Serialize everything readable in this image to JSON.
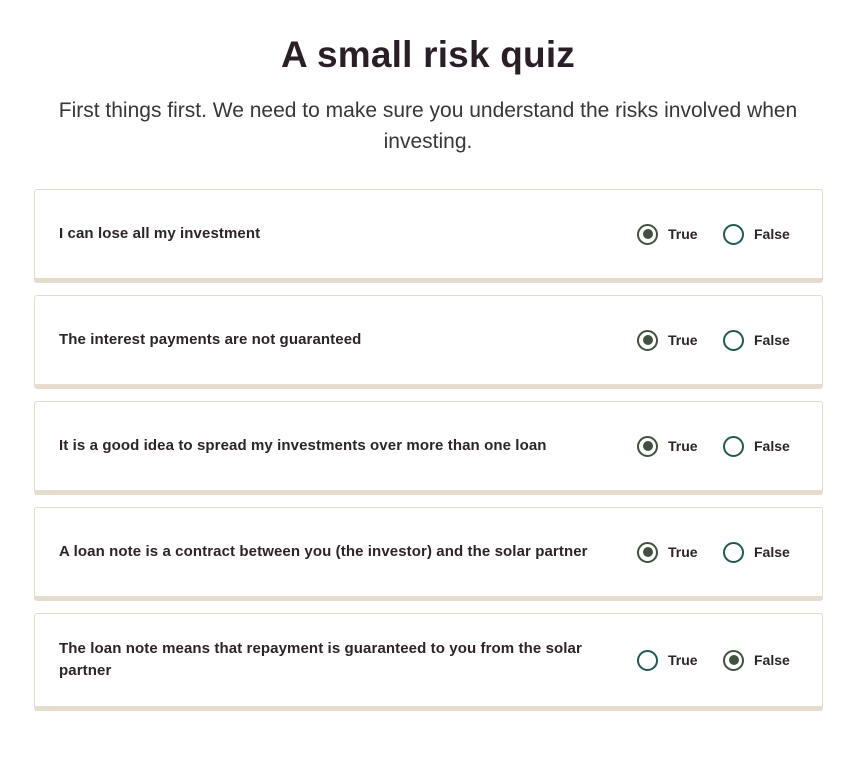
{
  "page": {
    "title": "A small risk quiz",
    "subtitle": "First things first. We need to make sure you understand the risks involved when investing."
  },
  "options": {
    "true_label": "True",
    "false_label": "False"
  },
  "questions": [
    {
      "text": "I can lose all my investment",
      "selected": "True"
    },
    {
      "text": "The interest payments are not guaranteed",
      "selected": "True"
    },
    {
      "text": "It is a good idea to spread my investments over more than one loan",
      "selected": "True"
    },
    {
      "text": "A loan note is a contract between you (the investor) and the solar partner",
      "selected": "True"
    },
    {
      "text": "The loan note means that repayment is guaranteed to you from the solar partner",
      "selected": "False"
    }
  ],
  "colors": {
    "radio_checked": "#40513f",
    "radio_unchecked": "#1f5a52",
    "card_border": "#e2dccb",
    "card_shadow": "#e6dccd"
  }
}
